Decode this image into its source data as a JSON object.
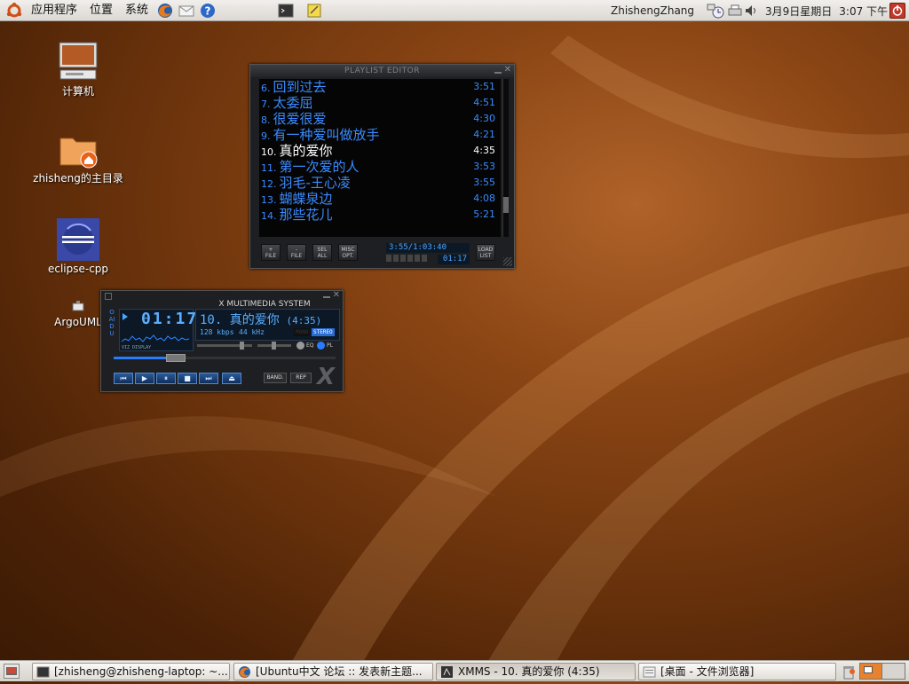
{
  "top_panel": {
    "menus": [
      "应用程序",
      "位置",
      "系统"
    ],
    "user": "ZhishengZhang",
    "date": "3月9日星期日",
    "time": "3:07 下午"
  },
  "desktop": {
    "icons": [
      {
        "label": "计算机",
        "icon": "computer-icon"
      },
      {
        "label": "zhisheng的主目录",
        "icon": "home-folder-icon"
      },
      {
        "label": "eclipse-cpp",
        "icon": "eclipse-icon"
      },
      {
        "label": "ArgoUML",
        "icon": "argouml-icon"
      }
    ]
  },
  "playlist": {
    "title": "PLAYLIST EDITOR",
    "tracks": [
      {
        "num": "6.",
        "title": "回到过去",
        "duration": "3:51"
      },
      {
        "num": "7.",
        "title": "太委屈",
        "duration": "4:51"
      },
      {
        "num": "8.",
        "title": "很爱很爱",
        "duration": "4:30"
      },
      {
        "num": "9.",
        "title": "有一种爱叫做放手",
        "duration": "4:21"
      },
      {
        "num": "10.",
        "title": "真的爱你",
        "duration": "4:35"
      },
      {
        "num": "11.",
        "title": "第一次爱的人",
        "duration": "3:53"
      },
      {
        "num": "12.",
        "title": "羽毛-王心凌",
        "duration": "3:55"
      },
      {
        "num": "13.",
        "title": "蝴蝶泉边",
        "duration": "4:08"
      },
      {
        "num": "14.",
        "title": "那些花儿",
        "duration": "5:21"
      }
    ],
    "current_index": 4,
    "buttons": [
      {
        "top": "+",
        "bottom": "FILE"
      },
      {
        "top": "-",
        "bottom": "FILE"
      },
      {
        "top": "SEL",
        "bottom": "ALL"
      },
      {
        "top": "MISC",
        "bottom": "OPT."
      },
      {
        "top": "LOAD",
        "bottom": "LIST"
      }
    ],
    "total_time": "3:55/1:03:40",
    "elapsed": "01:17"
  },
  "player": {
    "title": "X MULTIMEDIA SYSTEM",
    "side_label": "OAIDU",
    "time": "01:17",
    "vis_label": "VIZ DISPLAY",
    "track_title": "10. 真的爱你",
    "track_duration": "(4:35)",
    "kbps": "128",
    "kbps_unit": "kbps",
    "khz": "44",
    "khz_unit": "kHz",
    "mono": "MONO",
    "stereo": "STEREO",
    "eq_label": "EQ",
    "pl_label": "PL",
    "band_label": "BAND.",
    "rep_label": "REP",
    "logo": "X",
    "controls": [
      "prev",
      "play",
      "pause",
      "stop",
      "next",
      "eject"
    ],
    "progress": 0.28
  },
  "taskbar": {
    "tasks": [
      {
        "label": "[zhisheng@zhisheng-laptop: ~...",
        "icon": "terminal-icon",
        "active": false
      },
      {
        "label": "[Ubuntu中文 论坛 :: 发表新主题...",
        "icon": "firefox-icon",
        "active": false
      },
      {
        "label": "XMMS - 10. 真的爱你 (4:35)",
        "icon": "xmms-icon",
        "active": true
      },
      {
        "label": "[桌面 - 文件浏览器]",
        "icon": "file-browser-icon",
        "active": false
      }
    ]
  },
  "colors": {
    "desktop": "#7a3c10",
    "lcd_text": "#3a8bff",
    "panel": "#e6e3de"
  }
}
